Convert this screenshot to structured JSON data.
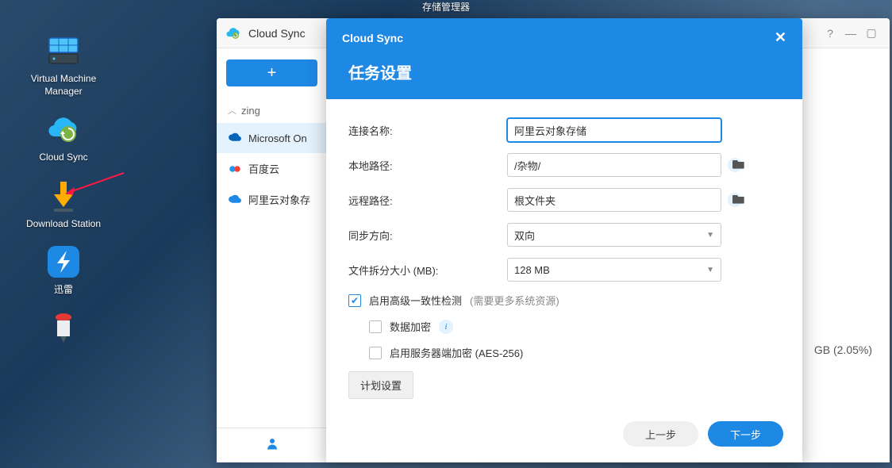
{
  "desktop": {
    "storage_manager": "存储管理器",
    "icons": [
      {
        "label": "Virtual Machine Manager"
      },
      {
        "label": "Cloud Sync"
      },
      {
        "label": "Download Station"
      },
      {
        "label": "迅雷"
      }
    ]
  },
  "app": {
    "title": "Cloud Sync",
    "add_label": "+",
    "group": "zing",
    "items": [
      {
        "label": "Microsoft On",
        "icon": "onedrive"
      },
      {
        "label": "百度云",
        "icon": "baidu"
      },
      {
        "label": "阿里云对象存",
        "icon": "aliyun"
      }
    ],
    "usage_text": "GB (2.05%)",
    "window_buttons": {
      "help": "?",
      "min": "—",
      "max": "▢"
    }
  },
  "modal": {
    "app_title": "Cloud Sync",
    "heading": "任务设置",
    "fields": {
      "conn_name_label": "连接名称:",
      "conn_name_value": "阿里云对象存储",
      "local_path_label": "本地路径:",
      "local_path_value": "/杂物/",
      "remote_path_label": "远程路径:",
      "remote_path_value": "根文件夹",
      "sync_dir_label": "同步方向:",
      "sync_dir_value": "双向",
      "split_size_label": "文件拆分大小 (MB):",
      "split_size_value": "128 MB"
    },
    "checks": {
      "adv_consistency": "启用高级一致性检测",
      "adv_consistency_hint": "(需要更多系统资源)",
      "data_enc": "数据加密",
      "server_enc": "启用服务器端加密 (AES-256)"
    },
    "schedule_btn": "计划设置",
    "prev": "上一步",
    "next": "下一步"
  }
}
